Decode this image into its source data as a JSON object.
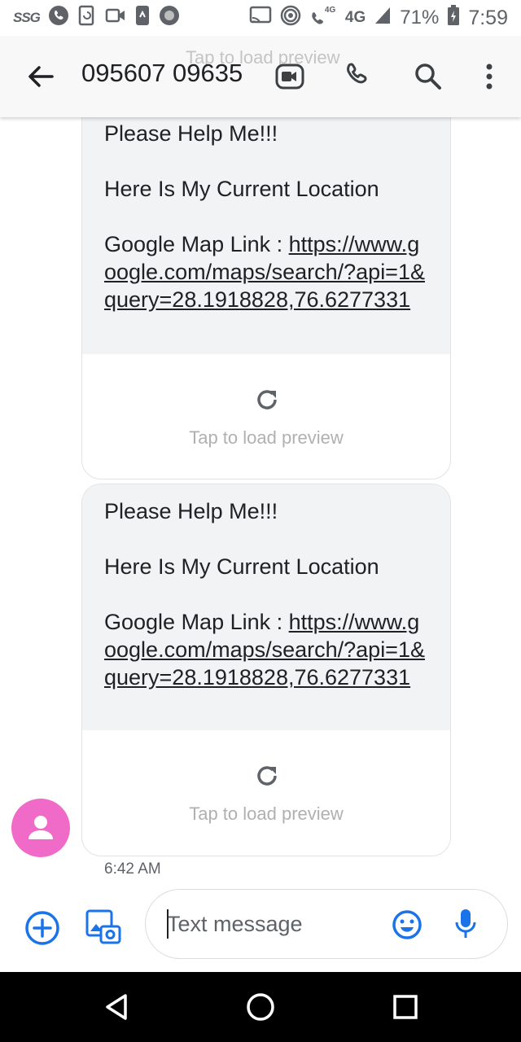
{
  "status_bar": {
    "carrier_badge": "SSG",
    "network_badge": "4G",
    "network_type": "4G",
    "battery_percent": "71%",
    "time": "7:59"
  },
  "header": {
    "title": "095607 09635",
    "ghost_text": "Tap to load preview"
  },
  "messages": [
    {
      "line1": "Please Help Me!!!",
      "line2": "Here Is My Current Location",
      "link_label": "Google Map Link : ",
      "link_url": "https://www.google.com/maps/search/?api=1&query=28.1918828,76.6277331",
      "preview_text": "Tap to load preview"
    },
    {
      "line1": "Please Help Me!!!",
      "line2": "Here Is My Current Location",
      "link_label": "Google Map Link : ",
      "link_url": "https://www.google.com/maps/search/?api=1&query=28.1918828,76.6277331",
      "preview_text": "Tap to load preview"
    }
  ],
  "timestamp": "6:42 AM",
  "compose": {
    "placeholder": "Text message"
  },
  "colors": {
    "accent_blue": "#1a73e8",
    "avatar_pink": "#f06bc8",
    "bubble_gray": "#f1f3f4"
  }
}
